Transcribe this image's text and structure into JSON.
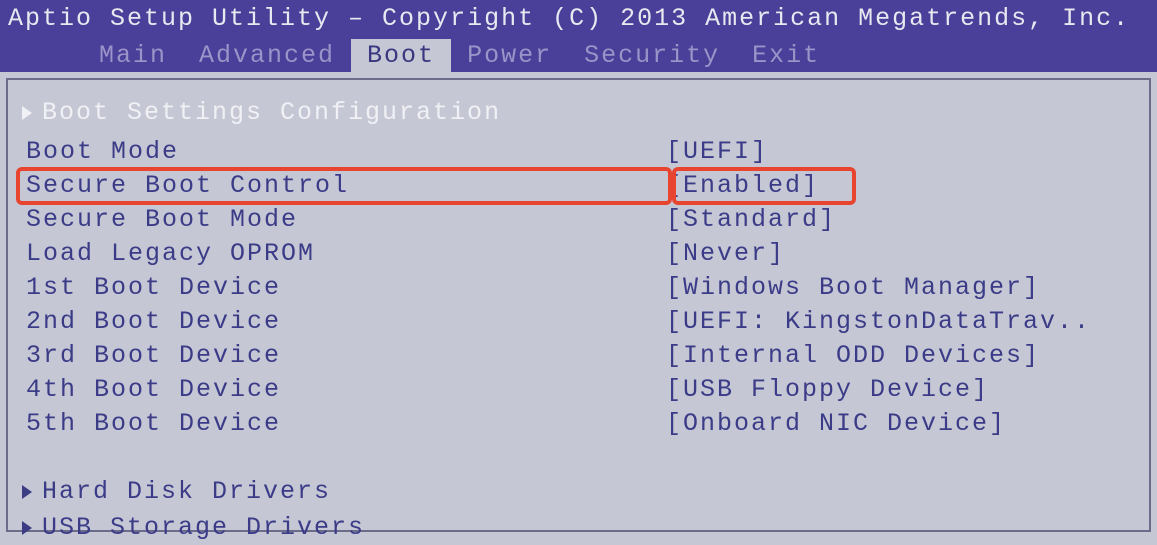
{
  "header": {
    "title": "Aptio Setup Utility – Copyright (C) 2013 American Megatrends, Inc."
  },
  "tabs": [
    {
      "label": "Main",
      "active": false
    },
    {
      "label": "Advanced",
      "active": false
    },
    {
      "label": "Boot",
      "active": true
    },
    {
      "label": "Power",
      "active": false
    },
    {
      "label": "Security",
      "active": false
    },
    {
      "label": "Exit",
      "active": false
    }
  ],
  "section": {
    "title": "Boot Settings Configuration"
  },
  "settings": [
    {
      "label": "Boot Mode",
      "value": "[UEFI]",
      "highlighted": false
    },
    {
      "label": "Secure Boot Control",
      "value": "[Enabled]",
      "highlighted": true
    },
    {
      "label": "Secure Boot Mode",
      "value": "[Standard]",
      "highlighted": false
    },
    {
      "label": "Load Legacy OPROM",
      "value": "[Never]",
      "highlighted": false
    },
    {
      "label": "1st Boot Device",
      "value": "[Windows Boot Manager]",
      "highlighted": false
    },
    {
      "label": "2nd Boot Device",
      "value": "[UEFI: KingstonDataTrav..",
      "highlighted": false
    },
    {
      "label": "3rd Boot Device",
      "value": "[Internal ODD Devices]",
      "highlighted": false
    },
    {
      "label": "4th Boot Device",
      "value": "[USB Floppy Device]",
      "highlighted": false
    },
    {
      "label": "5th Boot Device",
      "value": "[Onboard NIC Device]",
      "highlighted": false
    }
  ],
  "submenus": [
    {
      "label": "Hard Disk Drivers"
    },
    {
      "label": "USB Storage Drivers"
    }
  ]
}
